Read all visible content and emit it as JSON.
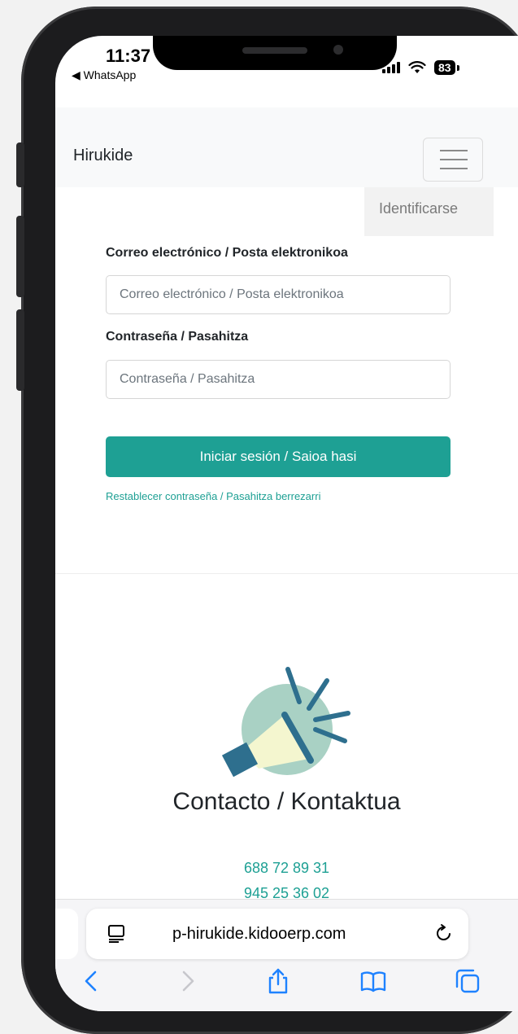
{
  "status_bar": {
    "time": "11:37",
    "back_app": "◀ WhatsApp",
    "battery": "83"
  },
  "navbar": {
    "brand": "Hirukide",
    "menu_item": "Identificarse"
  },
  "login": {
    "email_label": "Correo electrónico / Posta elektronikoa",
    "email_placeholder": "Correo electrónico / Posta elektronikoa",
    "password_label": "Contraseña / Pasahitza",
    "password_placeholder": "Contraseña / Pasahitza",
    "submit_label": "Iniciar sesión / Saioa hasi",
    "reset_link": "Restablecer contraseña / Pasahitza berrezarri"
  },
  "contact": {
    "title": "Contacto / Kontaktua",
    "phones": [
      "688 72 89 31",
      "945 25 36 02"
    ]
  },
  "browser": {
    "url": "p-hirukide.kidooerp.com"
  },
  "colors": {
    "accent": "#1ea094",
    "navbar_bg": "#f8f9fa",
    "megaphone_circle": "#a9d1c4",
    "megaphone_dark": "#2e6f8e",
    "megaphone_light": "#f4f6cf"
  }
}
